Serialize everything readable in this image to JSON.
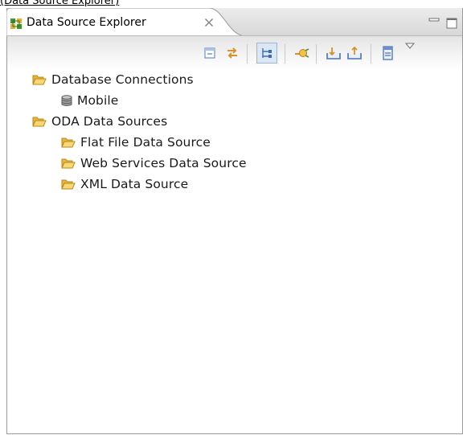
{
  "caption": "(Data Source Explorer)",
  "view": {
    "title": "Data Source Explorer",
    "close_glyph": "×"
  },
  "toolbar": {
    "buttons": [
      "collapse-all-icon",
      "link-with-editor-icon",
      "tree-layout-icon",
      "connect-icon",
      "import-icon",
      "export-icon",
      "filter-icon",
      "view-menu-icon"
    ]
  },
  "tree": {
    "items": [
      {
        "label": "Database Connections",
        "icon": "open-folder-icon",
        "level": 1
      },
      {
        "label": "Mobile",
        "icon": "database-icon",
        "level": 2
      },
      {
        "label": "ODA Data Sources",
        "icon": "open-folder-icon",
        "level": 1
      },
      {
        "label": "Flat File Data Source",
        "icon": "open-folder-icon",
        "level": 2
      },
      {
        "label": "Web Services Data Source",
        "icon": "open-folder-icon",
        "level": 2
      },
      {
        "label": "XML Data Source",
        "icon": "open-folder-icon",
        "level": 2
      }
    ]
  },
  "colors": {
    "folder": "#f0c040",
    "folder_edge": "#b98a1c",
    "database": "#8a8a8a",
    "accent_green": "#3f9a2e"
  }
}
